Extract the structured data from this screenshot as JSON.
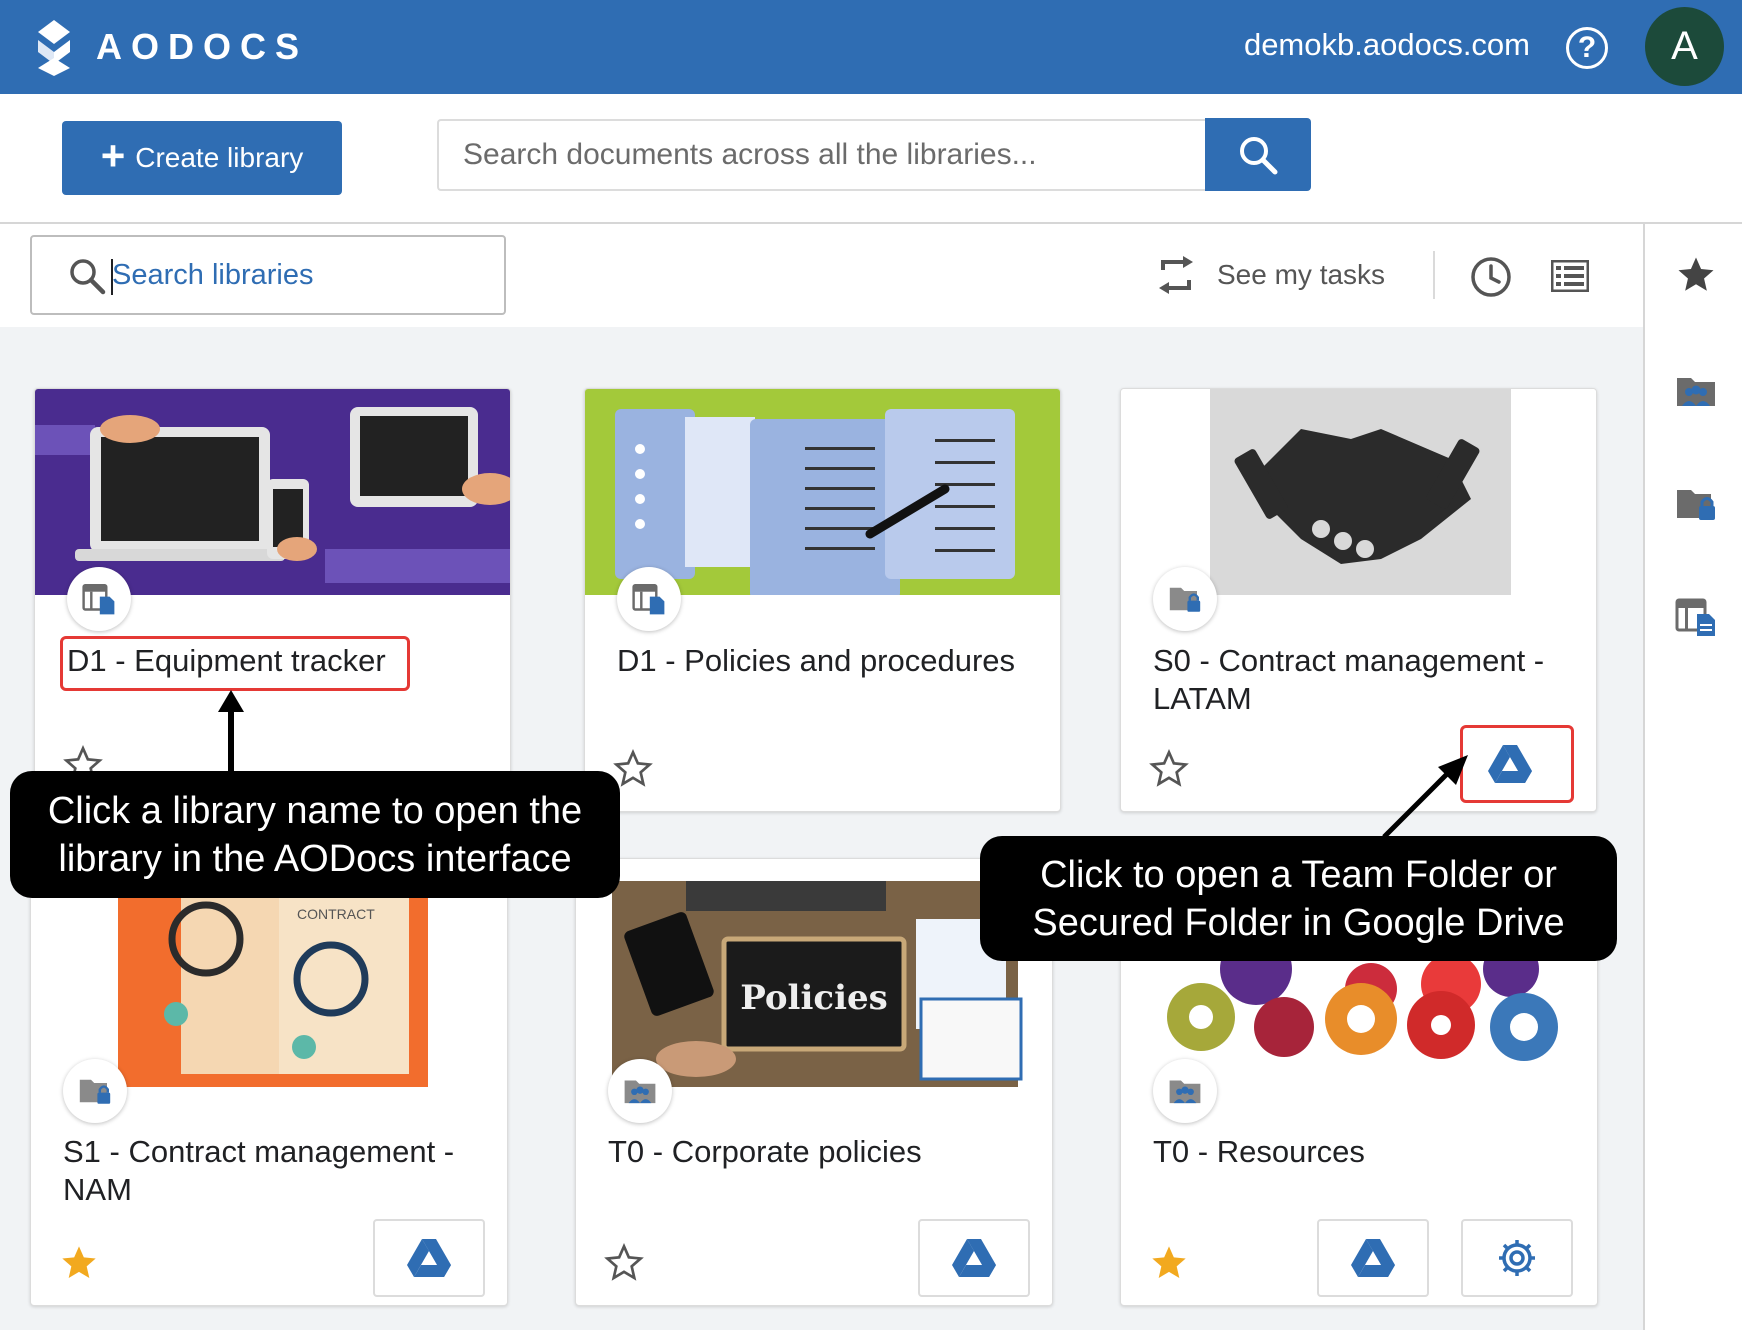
{
  "header": {
    "brand": "AODOCS",
    "domain": "demokb.aodocs.com",
    "help_label": "?",
    "avatar_initial": "A",
    "brand_color": "#2f6db3"
  },
  "toolbar": {
    "create_library_label": "Create library",
    "search_placeholder": "Search documents across all the libraries..."
  },
  "filters": {
    "search_libraries_placeholder": "Search libraries",
    "see_tasks_label": "See my tasks"
  },
  "right_rail": {
    "icons": [
      "star-icon",
      "team-folder-icon",
      "secured-folder-icon",
      "library-icon"
    ]
  },
  "libraries": [
    {
      "name": "D1 - Equipment tracker",
      "type_icon": "library-icon",
      "starred": false,
      "actions": []
    },
    {
      "name": "D1 - Policies and procedures",
      "type_icon": "library-icon",
      "starred": false,
      "actions": []
    },
    {
      "name": "S0 - Contract management - LATAM",
      "type_icon": "secured-folder-icon",
      "starred": false,
      "actions": [
        "google-drive-icon"
      ]
    },
    {
      "name": "S1 - Contract management - NAM",
      "type_icon": "secured-folder-icon",
      "starred": true,
      "actions": [
        "google-drive-icon"
      ]
    },
    {
      "name": "T0 - Corporate policies",
      "type_icon": "team-folder-icon",
      "starred": false,
      "actions": [
        "google-drive-icon"
      ]
    },
    {
      "name": "T0 - Resources",
      "type_icon": "team-folder-icon",
      "starred": true,
      "actions": [
        "google-drive-icon",
        "gear-icon"
      ]
    }
  ],
  "banners": {
    "contract_text": "CONTRACT",
    "policies_text": "Policies"
  },
  "callouts": {
    "library_name": "Click a library name to open the library in the AODocs interface",
    "drive_button": "Click to open a Team Folder or Secured Folder in Google Drive"
  }
}
